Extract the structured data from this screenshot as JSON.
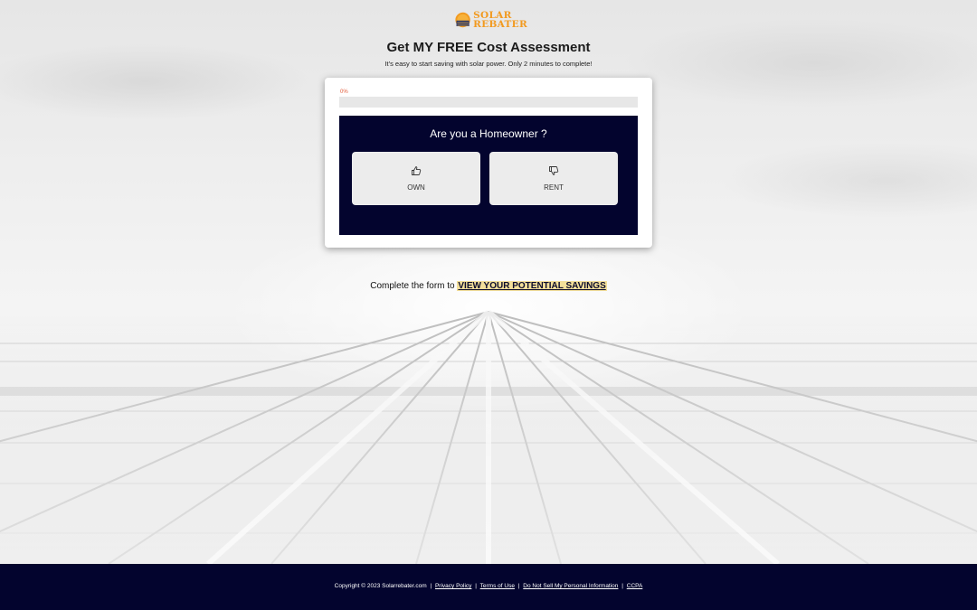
{
  "brand": {
    "line1": "SOLAR",
    "line2": "REBATER",
    "color": "#f29a1f"
  },
  "header": {
    "title": "Get MY FREE Cost Assessment",
    "subtitle": "It's easy to start saving with solar power. Only 2 minutes to complete!"
  },
  "form": {
    "progress_label": "0%",
    "progress_value": 0,
    "progress_color": "#e25c3a",
    "question": "Are you a Homeowner ?",
    "options": [
      {
        "label": "OWN",
        "icon": "thumbs-up-icon"
      },
      {
        "label": "RENT",
        "icon": "thumbs-down-icon"
      }
    ]
  },
  "cta": {
    "text": "Complete the form to",
    "link": "VIEW YOUR POTENTIAL SAVINGS"
  },
  "footer": {
    "copyright": "Copyright © 2023 Solarrebater.com",
    "separator": "|",
    "links": [
      "Privacy Policy",
      "Terms of Use",
      "Do Not Sell My Personal Information",
      "CCPA"
    ],
    "background": "#03042e"
  }
}
